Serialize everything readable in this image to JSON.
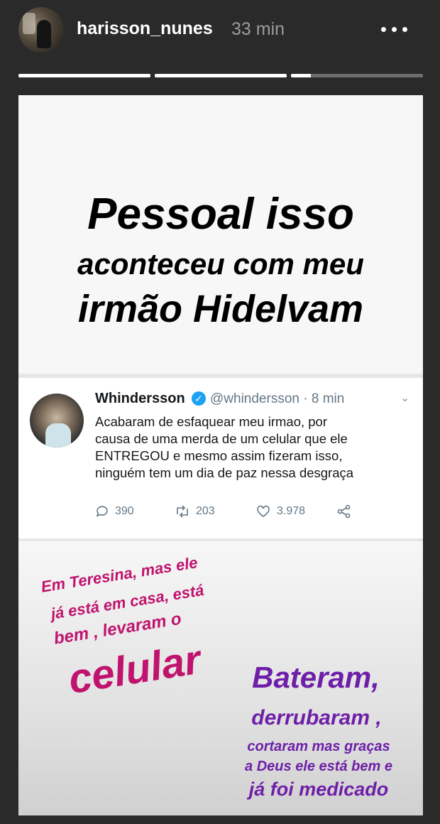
{
  "header": {
    "username": "harisson_nunes",
    "time": "33 min",
    "progress_segments": [
      1.0,
      1.0,
      0.15
    ]
  },
  "story": {
    "headline": [
      "Pessoal isso",
      "aconteceu com meu",
      "irmão Hidelvam"
    ],
    "tweet": {
      "name": "Whindersson",
      "handle": "@whindersson · 8 min",
      "text_lines": [
        "Acabaram de esfaquear meu irmao, por",
        "causa de uma merda de um celular que ele",
        "ENTREGOU e mesmo assim fizeram isso,",
        "ninguém tem um dia de paz nessa desgraça"
      ],
      "replies": "390",
      "retweets": "203",
      "likes": "3.978"
    },
    "pink_caption": [
      "Em Teresina, mas ele",
      "já está em casa, está",
      "bem , levaram o",
      "celular"
    ],
    "purple_caption": [
      "Bateram,",
      "derrubaram ,",
      "cortaram mas graças",
      "a Deus ele está bem e",
      "já foi medicado"
    ]
  },
  "colors": {
    "pink": "#c0136e",
    "purple": "#6e1fa8",
    "verified": "#1da1f2"
  }
}
